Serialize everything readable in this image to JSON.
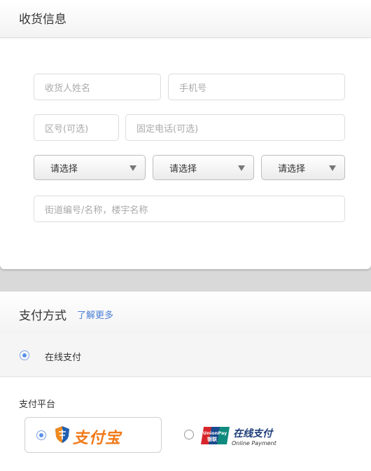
{
  "shipping": {
    "title": "收货信息",
    "name_placeholder": "收货人姓名",
    "phone_placeholder": "手机号",
    "area_code_placeholder": "区号(可选)",
    "landline_placeholder": "固定电话(可选)",
    "selects": [
      {
        "value": "请选择"
      },
      {
        "value": "请选择"
      },
      {
        "value": "请选择"
      }
    ],
    "address_placeholder": "街道编号/名称，楼宇名称"
  },
  "payment": {
    "title": "支付方式",
    "learn_more": "了解更多",
    "online_label": "在线支付",
    "platform_label": "支付平台",
    "alipay_logo_text": "支付宝",
    "unionpay_cn": "在线支付",
    "unionpay_en": "Online Payment",
    "unionpay_badge_text": "UnionPay 银联"
  },
  "colors": {
    "link": "#4a7fd6",
    "radio_selected": "#5b8fe8",
    "alipay_orange": "#f07a1a",
    "unionpay_blue": "#1e3e7a"
  },
  "icons": [
    "dropdown-arrow-icon",
    "alipay-shield-icon",
    "unionpay-logo-icon"
  ]
}
